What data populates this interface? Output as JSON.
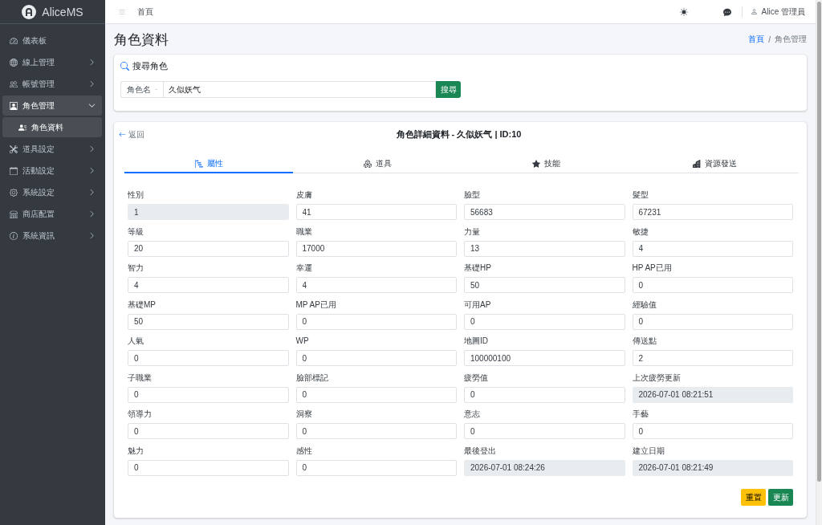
{
  "sidebar": {
    "brand": "AliceMS",
    "items": [
      {
        "label": "儀表板",
        "selected": false
      },
      {
        "label": "線上管理",
        "selected": false,
        "expanded": false
      },
      {
        "label": "帳號管理",
        "selected": false,
        "expanded": false
      },
      {
        "label": "角色管理",
        "selected": true,
        "expanded": true,
        "children": [
          {
            "label": "角色資料",
            "selected": true
          }
        ]
      },
      {
        "label": "道具設定",
        "selected": false,
        "expanded": false
      },
      {
        "label": "活動設定",
        "selected": false,
        "expanded": false
      },
      {
        "label": "系統設定",
        "selected": false,
        "expanded": false
      },
      {
        "label": "商店配置",
        "selected": false,
        "expanded": false
      },
      {
        "label": "系統資訊",
        "selected": false,
        "expanded": false
      }
    ]
  },
  "topbar": {
    "home_link": "首頁",
    "user": "Alice 管理員"
  },
  "page_header": {
    "title": "角色資料",
    "breadcrumb": [
      {
        "label": "首頁",
        "link": true
      },
      {
        "label": "角色管理",
        "link": false
      }
    ],
    "separator": "/"
  },
  "search": {
    "title": "搜尋角色",
    "field_type": "角色名",
    "value": "久似妖气",
    "button": "搜尋"
  },
  "detail": {
    "back": "返回",
    "title": "角色詳細資料 - 久似妖气 | ID:10",
    "tabs": [
      {
        "label": "屬性",
        "selected": true
      },
      {
        "label": "道具",
        "selected": false
      },
      {
        "label": "技能",
        "selected": false
      },
      {
        "label": "資源發送",
        "selected": false
      }
    ],
    "fields": [
      {
        "label": "性別",
        "value": "1",
        "disabled": true
      },
      {
        "label": "皮膚",
        "value": "41",
        "disabled": false
      },
      {
        "label": "臉型",
        "value": "56683",
        "disabled": false
      },
      {
        "label": "髮型",
        "value": "67231",
        "disabled": false
      },
      {
        "label": "等級",
        "value": "20",
        "disabled": false
      },
      {
        "label": "職業",
        "value": "17000",
        "disabled": false
      },
      {
        "label": "力量",
        "value": "13",
        "disabled": false
      },
      {
        "label": "敏捷",
        "value": "4",
        "disabled": false
      },
      {
        "label": "智力",
        "value": "4",
        "disabled": false
      },
      {
        "label": "幸運",
        "value": "4",
        "disabled": false
      },
      {
        "label": "基礎HP",
        "value": "50",
        "disabled": false
      },
      {
        "label": "HP AP已用",
        "value": "0",
        "disabled": false
      },
      {
        "label": "基礎MP",
        "value": "50",
        "disabled": false
      },
      {
        "label": "MP AP已用",
        "value": "0",
        "disabled": false
      },
      {
        "label": "可用AP",
        "value": "0",
        "disabled": false
      },
      {
        "label": "經驗值",
        "value": "0",
        "disabled": false
      },
      {
        "label": "人氣",
        "value": "0",
        "disabled": false
      },
      {
        "label": "WP",
        "value": "0",
        "disabled": false
      },
      {
        "label": "地圖ID",
        "value": "100000100",
        "disabled": false
      },
      {
        "label": "傳送點",
        "value": "2",
        "disabled": false
      },
      {
        "label": "子職業",
        "value": "0",
        "disabled": false
      },
      {
        "label": "臉部標記",
        "value": "0",
        "disabled": false
      },
      {
        "label": "疲勞值",
        "value": "0",
        "disabled": false
      },
      {
        "label": "上次疲勞更新",
        "value": "2026-07-01 08:21:51",
        "disabled": true
      },
      {
        "label": "領導力",
        "value": "0",
        "disabled": false
      },
      {
        "label": "洞察",
        "value": "0",
        "disabled": false
      },
      {
        "label": "意志",
        "value": "0",
        "disabled": false
      },
      {
        "label": "手藝",
        "value": "0",
        "disabled": false
      },
      {
        "label": "魅力",
        "value": "0",
        "disabled": false
      },
      {
        "label": "感性",
        "value": "0",
        "disabled": false
      },
      {
        "label": "最後登出",
        "value": "2026-07-01 08:24:26",
        "disabled": true
      },
      {
        "label": "建立日期",
        "value": "2026-07-01 08:21:49",
        "disabled": true
      }
    ],
    "buttons": [
      {
        "label": "重置",
        "kind": "warning"
      },
      {
        "label": "更新",
        "kind": "success"
      }
    ]
  }
}
